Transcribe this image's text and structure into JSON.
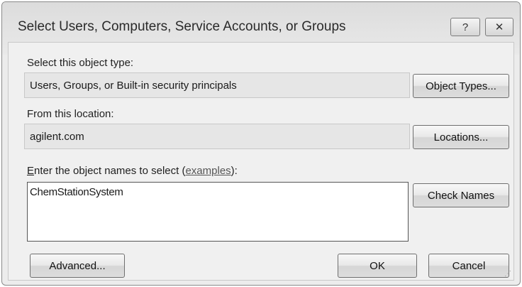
{
  "window": {
    "title": "Select Users, Computers, Service Accounts, or Groups",
    "help_glyph": "?",
    "close_glyph": "✕"
  },
  "object_type": {
    "label": "Select this object type:",
    "value": "Users, Groups, or Built-in security principals",
    "button": "Object Types..."
  },
  "location": {
    "label": "From this location:",
    "value": "agilent.com",
    "button": "Locations..."
  },
  "names": {
    "label_first_char": "E",
    "label_rest": "nter the object names to select (",
    "examples_link": "examples",
    "label_end": "):",
    "value": "ChemStationSystem",
    "check_button": "Check Names"
  },
  "footer": {
    "advanced_button": "Advanced...",
    "ok_button": "OK",
    "cancel_button": "Cancel"
  }
}
